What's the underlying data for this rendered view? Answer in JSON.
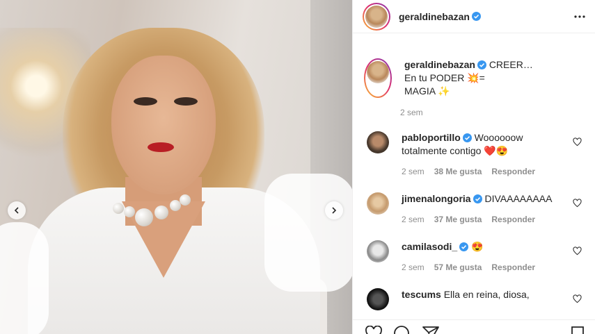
{
  "post": {
    "author": "geraldinebazan",
    "caption_lines": [
      "CREER…",
      "En tu PODER 💥=",
      "MAGIA ✨"
    ],
    "caption_time": "2 sem"
  },
  "comments": [
    {
      "user": "pabloportillo",
      "verified": true,
      "text_line1": "Woooooow",
      "text_line2": "totalmente contigo ❤️😍",
      "time": "2 sem",
      "likes": "38 Me gusta",
      "reply": "Responder"
    },
    {
      "user": "jimenalongoria",
      "verified": true,
      "text_line1": "DIVAAAAAAAA",
      "text_line2": "",
      "time": "2 sem",
      "likes": "37 Me gusta",
      "reply": "Responder"
    },
    {
      "user": "camilasodi_",
      "verified": true,
      "text_line1": "😍",
      "text_line2": "",
      "time": "2 sem",
      "likes": "57 Me gusta",
      "reply": "Responder"
    },
    {
      "user": "tescums",
      "verified": false,
      "text_line1": "Ella en reina, diosa,",
      "text_line2": ""
    }
  ],
  "icons": {
    "verified": "verified-badge-icon",
    "more": "more-options-icon",
    "heart": "heart-icon",
    "prev": "chevron-left-icon",
    "next": "chevron-right-icon",
    "like": "heart-icon",
    "comment": "comment-icon",
    "share": "share-icon",
    "save": "bookmark-icon"
  },
  "colors": {
    "verified": "#3897f0",
    "text": "#262626",
    "muted": "#8e8e8e"
  }
}
